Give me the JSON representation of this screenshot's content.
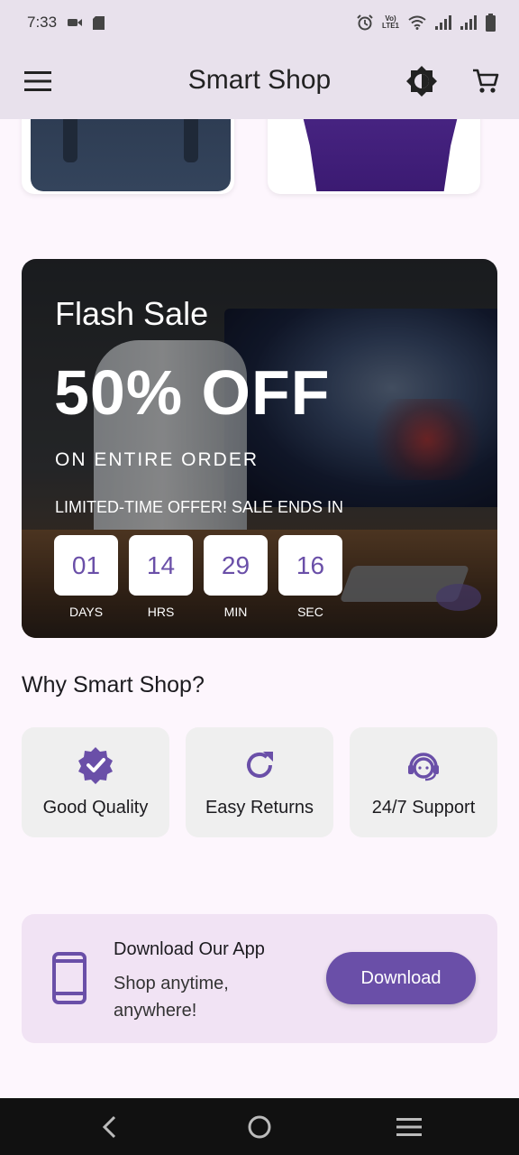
{
  "status_bar": {
    "time": "7:33",
    "left_icons": [
      "video-icon",
      "sd-card-icon"
    ],
    "right_icons": [
      "alarm-icon",
      "volte-icon",
      "wifi-icon",
      "signal-icon",
      "signal-icon",
      "battery-icon"
    ],
    "volte_text_top": "Vo)",
    "volte_text_bottom": "LTE1"
  },
  "app_bar": {
    "title": "Smart Shop",
    "icons": [
      "menu-icon",
      "brightness-icon",
      "cart-icon"
    ]
  },
  "flash_sale": {
    "title": "Flash Sale",
    "discount": "50% OFF",
    "subtitle": "ON ENTIRE ORDER",
    "limited_text": "LIMITED-TIME OFFER! SALE ENDS IN",
    "countdown": [
      {
        "value": "01",
        "label": "DAYS"
      },
      {
        "value": "14",
        "label": "HRS"
      },
      {
        "value": "29",
        "label": "MIN"
      },
      {
        "value": "16",
        "label": "SEC"
      }
    ]
  },
  "why": {
    "title": "Why Smart Shop?",
    "features": [
      {
        "label": "Good Quality",
        "icon": "verified-badge-icon"
      },
      {
        "label": "Easy Returns",
        "icon": "refresh-icon"
      },
      {
        "label": "24/7 Support",
        "icon": "support-agent-icon"
      }
    ]
  },
  "download": {
    "title": "Download Our App",
    "subtitle": "Shop anytime, anywhere!",
    "button_label": "Download",
    "icon": "smartphone-icon"
  },
  "nav_bar": {
    "icons": [
      "back-icon",
      "home-icon",
      "recents-icon"
    ]
  },
  "colors": {
    "primary": "#6a4fa8",
    "app_bar_bg": "#e8e1ec",
    "page_bg": "#fdf6fd",
    "card_bg": "#efefef",
    "download_bg": "#f1e3f4"
  }
}
